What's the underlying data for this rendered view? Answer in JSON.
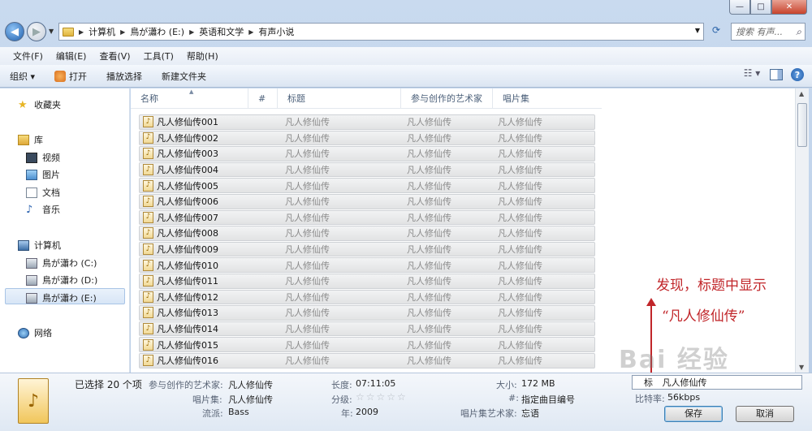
{
  "window": {
    "min": "—",
    "max": "□",
    "close": "✕"
  },
  "address": {
    "crumbs": [
      "计算机",
      "鳥が瀟わ (E:)",
      "英语和文学",
      "有声小说"
    ],
    "search_placeholder": "搜索 有声..."
  },
  "menu": [
    "文件(F)",
    "编辑(E)",
    "查看(V)",
    "工具(T)",
    "帮助(H)"
  ],
  "toolbar": {
    "organize": "组织 ▾",
    "open": "打开",
    "play_all": "播放选择",
    "new_folder": "新建文件夹"
  },
  "nav": {
    "favorites": "收藏夹",
    "libraries": "库",
    "videos": "视频",
    "pictures": "图片",
    "documents": "文档",
    "music": "音乐",
    "computer": "计算机",
    "drive_c": "鳥が瀟わ (C:)",
    "drive_d": "鳥が瀟わ (D:)",
    "drive_e": "鳥が瀟わ (E:)",
    "network": "网络"
  },
  "columns": {
    "name": "名称",
    "num": "#",
    "title": "标题",
    "artist": "参与创作的艺术家",
    "album": "唱片集"
  },
  "files": [
    {
      "name": "凡人修仙传001",
      "title": "凡人修仙传",
      "artist": "凡人修仙传",
      "album": "凡人修仙传"
    },
    {
      "name": "凡人修仙传002",
      "title": "凡人修仙传",
      "artist": "凡人修仙传",
      "album": "凡人修仙传"
    },
    {
      "name": "凡人修仙传003",
      "title": "凡人修仙传",
      "artist": "凡人修仙传",
      "album": "凡人修仙传"
    },
    {
      "name": "凡人修仙传004",
      "title": "凡人修仙传",
      "artist": "凡人修仙传",
      "album": "凡人修仙传"
    },
    {
      "name": "凡人修仙传005",
      "title": "凡人修仙传",
      "artist": "凡人修仙传",
      "album": "凡人修仙传"
    },
    {
      "name": "凡人修仙传006",
      "title": "凡人修仙传",
      "artist": "凡人修仙传",
      "album": "凡人修仙传"
    },
    {
      "name": "凡人修仙传007",
      "title": "凡人修仙传",
      "artist": "凡人修仙传",
      "album": "凡人修仙传"
    },
    {
      "name": "凡人修仙传008",
      "title": "凡人修仙传",
      "artist": "凡人修仙传",
      "album": "凡人修仙传"
    },
    {
      "name": "凡人修仙传009",
      "title": "凡人修仙传",
      "artist": "凡人修仙传",
      "album": "凡人修仙传"
    },
    {
      "name": "凡人修仙传010",
      "title": "凡人修仙传",
      "artist": "凡人修仙传",
      "album": "凡人修仙传"
    },
    {
      "name": "凡人修仙传011",
      "title": "凡人修仙传",
      "artist": "凡人修仙传",
      "album": "凡人修仙传"
    },
    {
      "name": "凡人修仙传012",
      "title": "凡人修仙传",
      "artist": "凡人修仙传",
      "album": "凡人修仙传"
    },
    {
      "name": "凡人修仙传013",
      "title": "凡人修仙传",
      "artist": "凡人修仙传",
      "album": "凡人修仙传"
    },
    {
      "name": "凡人修仙传014",
      "title": "凡人修仙传",
      "artist": "凡人修仙传",
      "album": "凡人修仙传"
    },
    {
      "name": "凡人修仙传015",
      "title": "凡人修仙传",
      "artist": "凡人修仙传",
      "album": "凡人修仙传"
    },
    {
      "name": "凡人修仙传016",
      "title": "凡人修仙传",
      "artist": "凡人修仙传",
      "album": "凡人修仙传"
    }
  ],
  "annotation": {
    "line1": "发现，标题中显示",
    "line2": "“凡人修仙传”"
  },
  "details": {
    "selected": "已选择 20 个项",
    "artist_label": "参与创作的艺术家:",
    "artist_value": "凡人修仙传",
    "album_label": "唱片集:",
    "album_value": "凡人修仙传",
    "genre_label": "流派:",
    "genre_value": "Bass",
    "length_label": "长度:",
    "length_value": "07:11:05",
    "rating_label": "分级:",
    "rating_stars": "☆☆☆☆☆",
    "year_label": "年:",
    "year_value": "2009",
    "size_label": "大小:",
    "size_value": "172 MB",
    "track_label": "#:",
    "track_value": "指定曲目编号",
    "album_artist_label": "唱片集艺术家:",
    "album_artist_value": "忘语",
    "title_label": "标",
    "title_value": "凡人修仙传",
    "bitrate_label": "比特率:",
    "bitrate_value": "56kbps"
  },
  "buttons": {
    "save": "保存",
    "cancel": "取消"
  },
  "watermark": "Bai 经验"
}
